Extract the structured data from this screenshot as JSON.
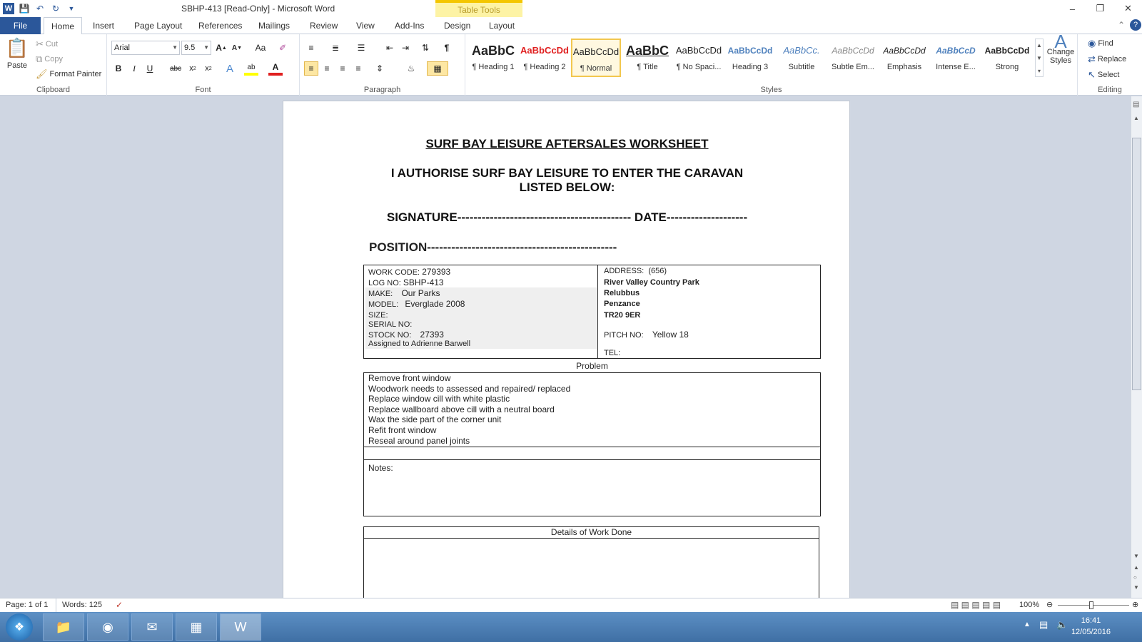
{
  "window": {
    "title": "SBHP-413 [Read-Only]  -  Microsoft Word",
    "context_tab": "Table Tools"
  },
  "tabs": [
    "File",
    "Home",
    "Insert",
    "Page Layout",
    "References",
    "Mailings",
    "Review",
    "View",
    "Add-Ins",
    "Design",
    "Layout"
  ],
  "clipboard": {
    "paste": "Paste",
    "cut": "Cut",
    "copy": "Copy",
    "format_painter": "Format Painter",
    "label": "Clipboard"
  },
  "font": {
    "name": "Arial",
    "size": "9.5",
    "label": "Font"
  },
  "paragraph": {
    "label": "Paragraph"
  },
  "styles": {
    "label": "Styles",
    "items": [
      {
        "sample": "AaBbC",
        "name": "¶ Heading 1"
      },
      {
        "sample": "AaBbCcDd",
        "name": "¶ Heading 2"
      },
      {
        "sample": "AaBbCcDd",
        "name": "¶ Normal"
      },
      {
        "sample": "AaBbC",
        "name": "¶ Title"
      },
      {
        "sample": "AaBbCcDd",
        "name": "¶ No Spaci..."
      },
      {
        "sample": "AaBbCcDd",
        "name": "Heading 3"
      },
      {
        "sample": "AaBbCc.",
        "name": "Subtitle"
      },
      {
        "sample": "AaBbCcDd",
        "name": "Subtle Em..."
      },
      {
        "sample": "AaBbCcDd",
        "name": "Emphasis"
      },
      {
        "sample": "AaBbCcD",
        "name": "Intense E..."
      },
      {
        "sample": "AaBbCcDd",
        "name": "Strong"
      }
    ],
    "change_styles": "Change Styles"
  },
  "editing": {
    "find": "Find",
    "replace": "Replace",
    "select": "Select",
    "label": "Editing"
  },
  "document": {
    "title": "SURF BAY LEISURE AFTERSALES WORKSHEET",
    "authorise_line1": "I AUTHORISE SURF BAY LEISURE TO ENTER THE CARAVAN",
    "authorise_line2": "LISTED BELOW:",
    "signature": "SIGNATURE------------------------------------------- DATE--------------------",
    "position": "POSITION-----------------------------------------------",
    "left": {
      "work_code_label": "WORK CODE:",
      "work_code": "279393",
      "log_no_label": "LOG NO:",
      "log_no": "SBHP-413",
      "make_label": "MAKE:",
      "make": "Our Parks",
      "model_label": "MODEL:",
      "model": "Everglade 2008",
      "size_label": "SIZE:",
      "serial_label": "SERIAL  NO:",
      "stock_label": "STOCK NO:",
      "stock": "27393",
      "assigned": "Assigned to Adrienne Barwell"
    },
    "right": {
      "address_label": "ADDRESS:",
      "address_code": "(656)",
      "address_lines": [
        "River Valley Country Park",
        "Relubbus",
        "Penzance",
        "TR20 9ER"
      ],
      "pitch_label": "PITCH NO:",
      "pitch": "Yellow 18",
      "tel_label": "TEL:"
    },
    "problem_label": "Problem",
    "problems": [
      "Remove front window",
      "Woodwork needs to assessed and repaired/ replaced",
      "Replace window cill with white plastic",
      "Replace wallboard above cill with a neutral board",
      "Wax the side part of the corner unit",
      "Refit front window",
      "Reseal around panel joints"
    ],
    "notes_label": "Notes:",
    "details_label": "Details of Work Done"
  },
  "status": {
    "page": "Page: 1 of 1",
    "words": "Words: 125",
    "zoom": "100%"
  },
  "clock": {
    "time": "16:41",
    "date": "12/05/2016"
  }
}
